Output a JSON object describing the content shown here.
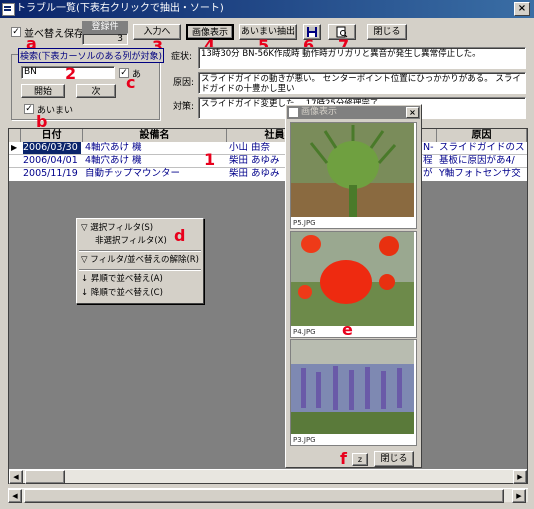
{
  "window": {
    "title": "トラブル一覧(下表右クリックで抽出・ソート)",
    "close": "×"
  },
  "toolbar": {
    "sort_save_label": "並べ替え保存",
    "registered_label": "登録件",
    "registered_count": "3",
    "input_button": "入力へ",
    "image_button": "画像表示",
    "fuzzy_extract_button": "あいまい抽出",
    "close_button": "閉じる"
  },
  "search": {
    "group_label": "検索(下表カーソルのある列が対象)",
    "value": "BN",
    "ah_label": "あ",
    "start_button": "開始",
    "next_button": "次",
    "fuzzy_label": "あいまい"
  },
  "details": {
    "symptom_label": "症状:",
    "symptom_text": "13時30分 BN-56K作成時 動作時ガリガリと異音が発生し異常停止した。",
    "cause_label": "原因:",
    "cause_text": "スライドガイドの動きが悪い。 センターボイント位置にひっかかりがある。 スライドガイドの十豊かし里い",
    "measure_label": "対策:",
    "measure_text": "スライドガイド変更した。 17時25分修理完了。"
  },
  "table": {
    "headers": [
      "日付",
      "設備名",
      "社員名",
      "原因"
    ],
    "rows": [
      {
        "date": "2006/03/30",
        "equipment": "4軸穴あけ 機",
        "employee": "小山 由奈",
        "mid": "N-",
        "cause": "スライドガイドのス"
      },
      {
        "date": "2006/04/01",
        "equipment": "4軸穴あけ 機",
        "employee": "柴田 あゆみ",
        "mid": "程",
        "cause": "基板に原因があ4/"
      },
      {
        "date": "2005/11/19",
        "equipment": "自動チップマウンター",
        "employee": "柴田 あゆみ",
        "mid": "が",
        "cause": "Y軸フォトセンサ交"
      }
    ]
  },
  "context_menu": {
    "items": [
      "選択フィルタ(S)",
      "非選択フィルタ(X)",
      "フィルタ/並べ替えの解除(R)",
      "昇順で並べ替え(A)",
      "降順で並べ替え(C)"
    ]
  },
  "image_dialog": {
    "title": "画像表示",
    "close": "×",
    "images": [
      {
        "caption": "P5.JPG",
        "subject": "green thistle bud"
      },
      {
        "caption": "P4.JPG",
        "subject": "red tulips"
      },
      {
        "caption": "P3.JPG",
        "subject": "purple salvia flowers"
      }
    ],
    "z_button": "z",
    "close_button": "閉じる"
  },
  "annotations": {
    "a": "a",
    "b": "b",
    "c": "c",
    "d": "d",
    "e": "e",
    "f": "f",
    "n1": "1",
    "n2": "2",
    "n3": "3",
    "n4": "4",
    "n5": "5",
    "n6": "6",
    "n7": "7"
  },
  "colors": {
    "titlebar": "#0a246a",
    "annotation": "#e8001c",
    "selection": "#0a246a",
    "face": "#d4d0c8"
  }
}
